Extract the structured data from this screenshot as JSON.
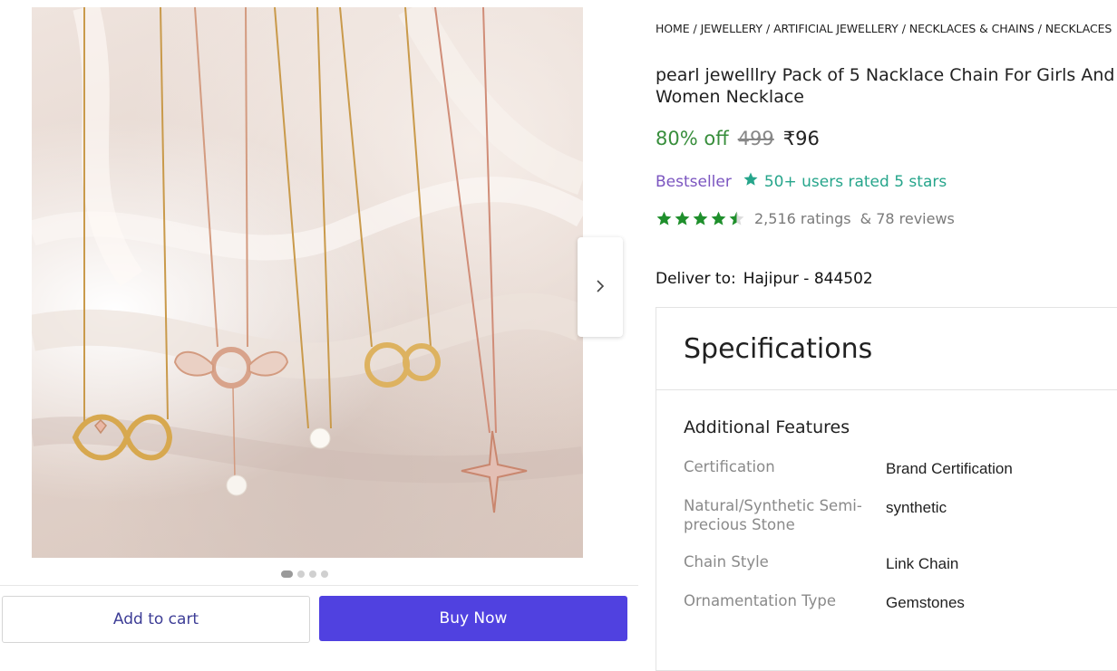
{
  "gallery": {
    "image_alt": "Five necklaces with pendants on silk",
    "next_icon": "chevron-right-icon",
    "dots": 4,
    "active_dot": 0
  },
  "actions": {
    "add_to_cart": "Add to cart",
    "buy_now": "Buy Now"
  },
  "breadcrumb": [
    "HOME",
    "JEWELLERY",
    "ARTIFICIAL JEWELLERY",
    "NECKLACES & CHAINS",
    "NECKLACES"
  ],
  "product": {
    "title": "pearl jewelllry Pack of 5 Nacklace Chain For Girls And Women Necklace",
    "discount": "80% off",
    "mrp": "499",
    "price": "₹96",
    "bestseller": "Bestseller",
    "rated_text": "50+ users rated 5 stars",
    "rating_value": 4.5,
    "ratings": "2,516 ratings",
    "reviews": "& 78 reviews"
  },
  "delivery": {
    "label": "Deliver to:",
    "location": "Hajipur - 844502"
  },
  "specs": {
    "heading": "Specifications",
    "section": "Additional Features",
    "rows": [
      {
        "key": "Certification",
        "value": "Brand Certification"
      },
      {
        "key": "Natural/Synthetic Semi-precious Stone",
        "value": "synthetic"
      },
      {
        "key": "Chain Style",
        "value": "Link Chain"
      },
      {
        "key": "Ornamentation Type",
        "value": "Gemstones"
      }
    ]
  },
  "colors": {
    "accent": "#5041e0",
    "discount": "#388e3c",
    "bestseller": "#7b55c0",
    "rated": "#26a58b",
    "star": "#1f8f2c"
  }
}
